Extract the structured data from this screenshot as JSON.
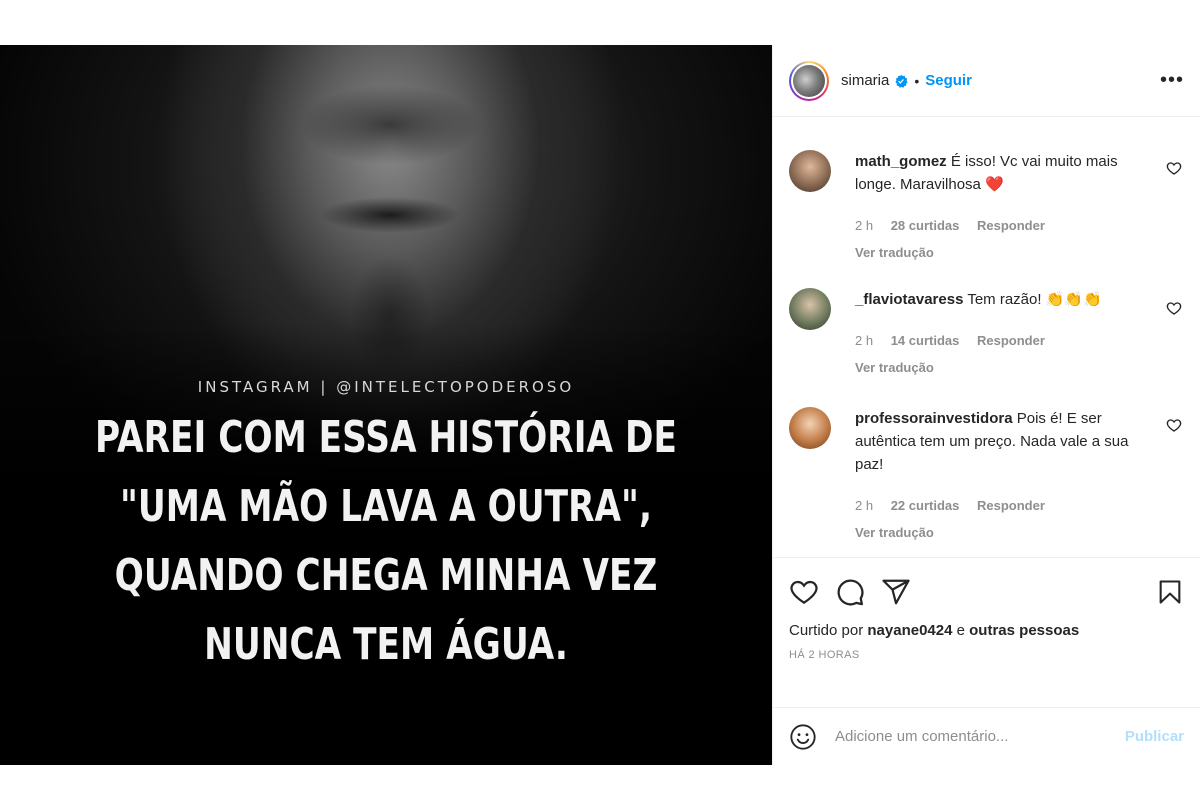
{
  "post": {
    "watermark": "INSTAGRAM | @INTELECTOPODEROSO",
    "quote_lines": [
      "PAREI COM ESSA HISTÓRIA DE",
      "\"UMA MÃO LAVA A OUTRA\",",
      "QUANDO CHEGA MINHA VEZ",
      "NUNCA TEM ÁGUA."
    ]
  },
  "header": {
    "username": "simaria",
    "separator": "•",
    "follow_label": "Seguir",
    "more_label": "•••",
    "icons": {
      "verified": "verified-badge-icon",
      "more": "more-options-icon"
    }
  },
  "comments": [
    {
      "user": "math_gomez",
      "text": "É isso! Vc vai muito mais longe. Maravilhosa",
      "emoji": "❤️",
      "time": "2 h",
      "likes": "28 curtidas",
      "reply": "Responder",
      "translate": "Ver tradução",
      "avatar_color": "#8a6a52"
    },
    {
      "user": "_flaviotavaress",
      "text": "Tem razão!",
      "emoji": "👏👏👏",
      "time": "2 h",
      "likes": "14 curtidas",
      "reply": "Responder",
      "translate": "Ver tradução",
      "avatar_color": "#6f7a5e"
    },
    {
      "user": "professorainvestidora",
      "text": "Pois é! E ser autêntica tem um preço. Nada vale a sua paz!",
      "emoji": "",
      "time": "2 h",
      "likes": "22 curtidas",
      "reply": "Responder",
      "translate": "Ver tradução",
      "avatar_color": "#c07a45"
    }
  ],
  "actions": {
    "liked_by_prefix": "Curtido por",
    "liked_by_user": "nayane0424",
    "liked_by_joiner": "e",
    "liked_by_suffix": "outras pessoas",
    "timestamp": "HÁ 2 HORAS",
    "icons": [
      "heart-icon",
      "comment-icon",
      "share-icon",
      "bookmark-icon"
    ]
  },
  "add_comment": {
    "placeholder": "Adicione um comentário...",
    "publish_label": "Publicar",
    "icon": "emoji-icon"
  },
  "colors": {
    "accent": "#0095f6",
    "publish_disabled": "#b2dffc",
    "muted": "#8e8e8e",
    "heart": "#ed4956"
  }
}
